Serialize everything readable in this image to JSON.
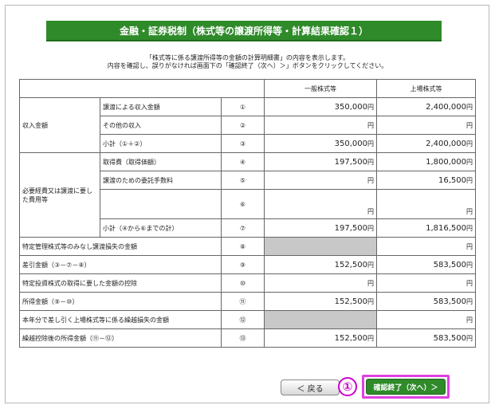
{
  "title": "金融・証券税制（株式等の譲渡所得等・計算結果確認１）",
  "description": {
    "line1": "「株式等に係る譲渡所得等の金額の計算明細書」の内容を表示します。",
    "line2": "内容を確認し、誤りがなければ画面下の「確認終了（次へ）＞」ボタンをクリックしてください。"
  },
  "columns": {
    "general": "一般株式等",
    "listed": "上場株式等"
  },
  "unit": "円",
  "rows": [
    {
      "group": "収入金額",
      "label": "譲渡による収入金額",
      "no": "①",
      "general": "350,000",
      "listed": "2,400,000"
    },
    {
      "label": "その他の収入",
      "no": "②",
      "general": "",
      "listed": ""
    },
    {
      "label": "小計（①＋②）",
      "no": "③",
      "general": "350,000",
      "listed": "2,400,000"
    },
    {
      "group": "必要経費又は譲渡に要した費用等",
      "label": "取得費（取得価額）",
      "no": "④",
      "general": "197,500",
      "listed": "1,800,000"
    },
    {
      "label": "譲渡のための委託手数料",
      "no": "⑤",
      "general": "",
      "listed": "16,500"
    },
    {
      "label": "",
      "no": "⑥",
      "general": "",
      "listed": ""
    },
    {
      "label": "小計（④から⑥までの計）",
      "no": "⑦",
      "general": "197,500",
      "listed": "1,816,500"
    },
    {
      "label": "特定管理株式等のみなし譲渡損失の金額",
      "no": "⑧",
      "general": "",
      "listed": ""
    },
    {
      "label": "差引金額（③－⑦－⑧）",
      "no": "⑨",
      "general": "152,500",
      "listed": "583,500"
    },
    {
      "label": "特定投資株式の取得に要した金額の控除",
      "no": "⑩",
      "general": "",
      "listed": ""
    },
    {
      "label": "所得金額（⑨－⑩）",
      "no": "⑪",
      "general": "152,500",
      "listed": "583,500"
    },
    {
      "label": "本年分で差し引く上場株式等に係る繰越損失の金額",
      "no": "⑫",
      "general": "",
      "listed": ""
    },
    {
      "label": "繰越控除後の所得金額（⑪－⑫）",
      "no": "⑬",
      "general": "152,500",
      "listed": "583,500"
    }
  ],
  "buttons": {
    "back": "＜ 戻る",
    "confirm": "確認終了（次へ）＞"
  },
  "badge": "①",
  "colors": {
    "accent": "#2f8a2a",
    "highlight": "#e040e0",
    "disabled": "#c8c8c8"
  }
}
